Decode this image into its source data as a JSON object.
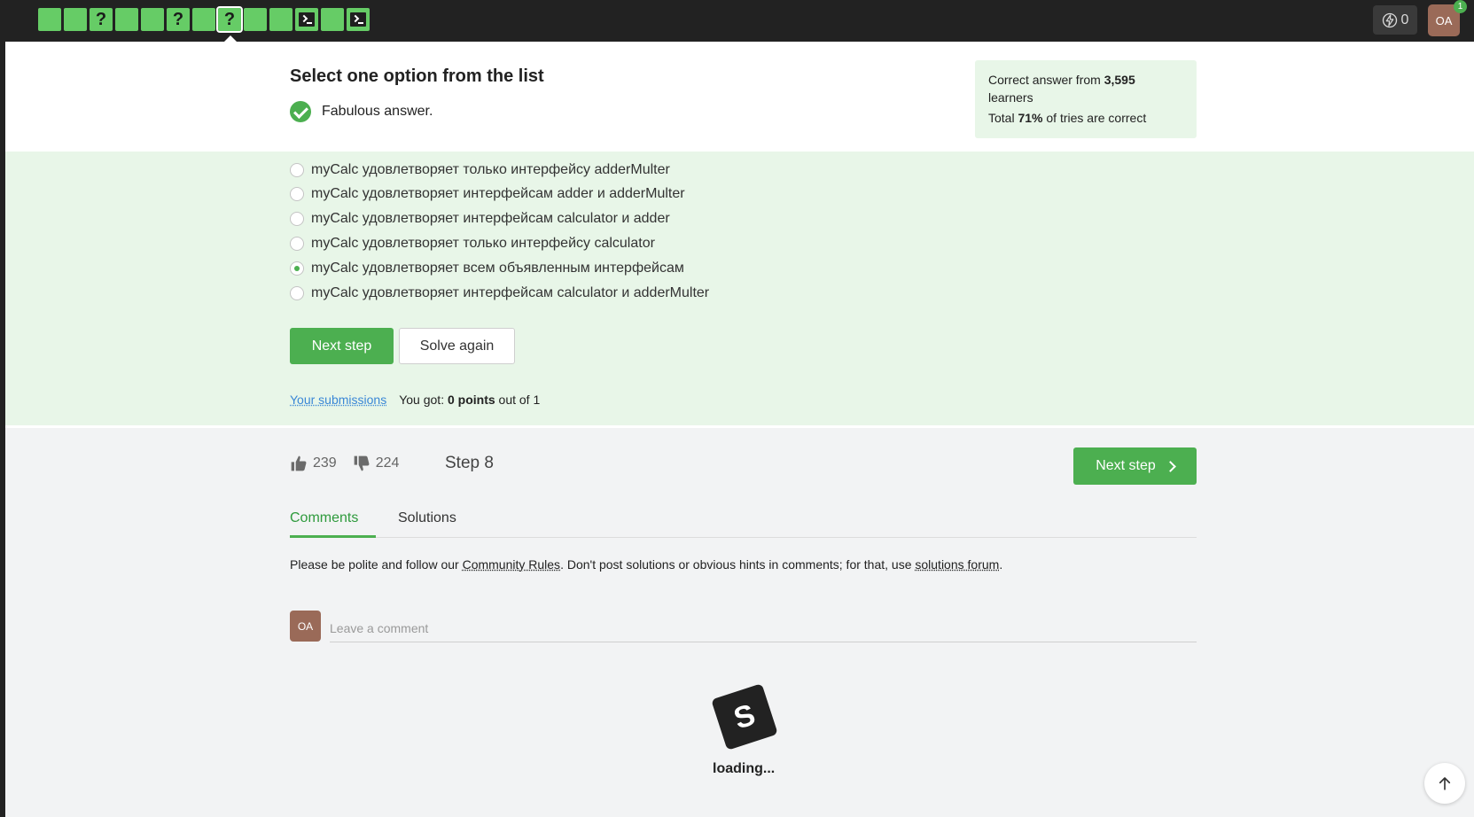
{
  "topbar": {
    "steps": [
      {
        "kind": "text"
      },
      {
        "kind": "text"
      },
      {
        "kind": "quiz"
      },
      {
        "kind": "text"
      },
      {
        "kind": "text"
      },
      {
        "kind": "quiz"
      },
      {
        "kind": "text"
      },
      {
        "kind": "quiz",
        "current": true
      },
      {
        "kind": "text"
      },
      {
        "kind": "code"
      },
      {
        "kind": "text"
      },
      {
        "kind": "text"
      },
      {
        "kind": "code"
      }
    ],
    "energy_count": "0",
    "avatar_initials": "OA",
    "notification_count": "1"
  },
  "question": {
    "title": "Select one option from the list",
    "verdict": "Fabulous answer."
  },
  "stats": {
    "line1_prefix": "Correct answer from ",
    "line1_count": "3,595",
    "line1_suffix": " learners",
    "line2_prefix": "Total ",
    "line2_percent": "71%",
    "line2_suffix": " of tries are correct"
  },
  "options": [
    {
      "label": "myCalc удовлетворяет только интерфейсу adderMulter",
      "checked": false
    },
    {
      "label": "myCalc удовлетворяет интерфейсам adder и adderMulter",
      "checked": false
    },
    {
      "label": "myCalc удовлетворяет интерфейсам calculator и adder",
      "checked": false
    },
    {
      "label": "myCalc удовлетворяет только интерфейсу calculator",
      "checked": false
    },
    {
      "label": "myCalc удовлетворяет всем объявленным интерфейсам",
      "checked": true
    },
    {
      "label": "myCalc удовлетворяет интерфейсам calculator и adderMulter",
      "checked": false
    }
  ],
  "actions": {
    "next_label": "Next step",
    "again_label": "Solve again"
  },
  "submissions": {
    "link": "Your submissions",
    "got_prefix": "You got: ",
    "points": "0 points",
    "got_suffix": " out of 1"
  },
  "footer": {
    "likes": "239",
    "dislikes": "224",
    "step_label": "Step 8",
    "next_label": "Next step"
  },
  "tabs": {
    "comments": "Comments",
    "solutions": "Solutions"
  },
  "rules": {
    "p1": "Please be polite and follow our ",
    "link1": "Community Rules",
    "p2": ". Don't post solutions or obvious hints in comments; for that, use ",
    "link2": "solutions forum",
    "p3": "."
  },
  "comment": {
    "avatar_initials": "OA",
    "placeholder": "Leave a comment"
  },
  "loader": {
    "text": "loading..."
  },
  "colors": {
    "accent": "#4caf50",
    "topbar": "#222222",
    "options_bg": "#e8f6e8",
    "step_done": "#66cc66"
  }
}
